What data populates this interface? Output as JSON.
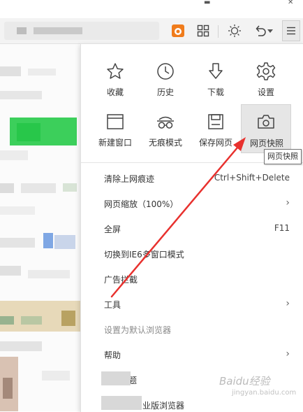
{
  "toolbar": {
    "icons": [
      "extension-icon",
      "grid-icon",
      "brightness-icon",
      "undo-icon",
      "chevron-down-icon",
      "menu-icon"
    ]
  },
  "quick_actions": [
    {
      "label": "收藏",
      "icon": "star-icon"
    },
    {
      "label": "历史",
      "icon": "clock-icon"
    },
    {
      "label": "下载",
      "icon": "download-icon"
    },
    {
      "label": "设置",
      "icon": "gear-icon"
    },
    {
      "label": "新建窗口",
      "icon": "window-icon"
    },
    {
      "label": "无痕模式",
      "icon": "incognito-icon"
    },
    {
      "label": "保存网页",
      "icon": "save-icon"
    },
    {
      "label": "网页快照",
      "icon": "camera-icon"
    }
  ],
  "menu_items": [
    {
      "label": "清除上网痕迹",
      "shortcut": "Ctrl+Shift+Delete"
    },
    {
      "label": "网页缩放（100%）",
      "submenu": "›"
    },
    {
      "label": "全屏",
      "shortcut": "F11"
    },
    {
      "label": "切换到IE6多窗口模式"
    },
    {
      "label": "广告拦截"
    },
    {
      "label": "工具",
      "submenu": "›"
    },
    {
      "label": "设置为默认浏览器"
    },
    {
      "label": "帮助",
      "submenu": "›"
    },
    {
      "label": "题"
    },
    {
      "label": "业版浏览器"
    }
  ],
  "tooltip": "网页快照",
  "watermark": {
    "text": "Baidu经验",
    "sub": "jingyan.baidu.com"
  },
  "colors": {
    "annotation_arrow": "#e8312e",
    "accent_extension": "#f07c1c"
  }
}
